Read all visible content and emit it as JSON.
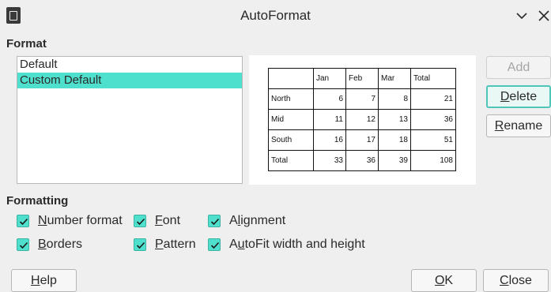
{
  "window": {
    "title": "AutoFormat"
  },
  "format_section": {
    "label": "Format",
    "items": [
      {
        "label": "Default",
        "selected": false
      },
      {
        "label": "Custom Default",
        "selected": true
      }
    ]
  },
  "preview": {
    "header": [
      "",
      "Jan",
      "Feb",
      "Mar",
      "Total"
    ],
    "rows": [
      [
        "North",
        "6",
        "7",
        "8",
        "21"
      ],
      [
        "Mid",
        "11",
        "12",
        "13",
        "36"
      ],
      [
        "South",
        "16",
        "17",
        "18",
        "51"
      ],
      [
        "Total",
        "33",
        "36",
        "39",
        "108"
      ]
    ]
  },
  "side_buttons": {
    "add": {
      "label": "Add",
      "enabled": false
    },
    "delete": {
      "pre": "",
      "mnemonic": "D",
      "post": "elete"
    },
    "rename": {
      "pre": "",
      "mnemonic": "R",
      "post": "ename"
    }
  },
  "formatting_section": {
    "label": "Formatting",
    "number_format": {
      "pre": "",
      "mnemonic": "N",
      "post": "umber format",
      "checked": true
    },
    "font": {
      "pre": "",
      "mnemonic": "F",
      "post": "ont",
      "checked": true
    },
    "alignment": {
      "pre": "A",
      "mnemonic": "l",
      "post": "ignment",
      "checked": true
    },
    "borders": {
      "pre": "",
      "mnemonic": "B",
      "post": "orders",
      "checked": true
    },
    "pattern": {
      "pre": "",
      "mnemonic": "P",
      "post": "attern",
      "checked": true
    },
    "autofit": {
      "pre": "A",
      "mnemonic": "u",
      "post": "toFit width and height",
      "checked": true
    }
  },
  "footer": {
    "help": {
      "pre": "",
      "mnemonic": "H",
      "post": "elp"
    },
    "ok": {
      "pre": "",
      "mnemonic": "O",
      "post": "K"
    },
    "close": {
      "pre": "",
      "mnemonic": "C",
      "post": "lose"
    }
  },
  "colors": {
    "selection": "#4fe0cd",
    "focus_border": "#4fc7b8",
    "background": "#efefef"
  },
  "icons": [
    "app-document-icon",
    "chevron-down-icon",
    "close-icon",
    "checkmark-icon"
  ]
}
